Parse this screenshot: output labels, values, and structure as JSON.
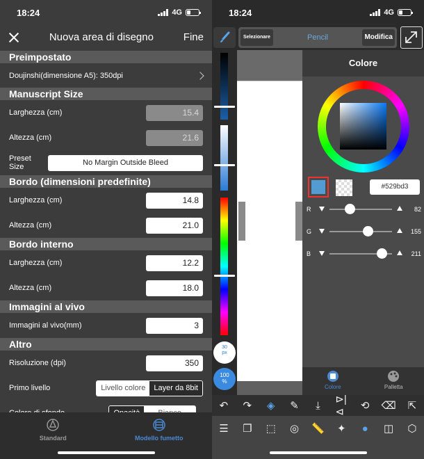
{
  "left": {
    "status_time": "18:24",
    "status_network": "4G",
    "nav": {
      "title": "Nuova area di disegno",
      "done": "Fine"
    },
    "preset": {
      "header": "Preimpostato",
      "value": "Doujinshi(dimensione A5): 350dpi"
    },
    "manuscript": {
      "header": "Manuscript Size",
      "width_label": "Larghezza (cm)",
      "width_value": "15.4",
      "height_label": "Altezza (cm)",
      "height_value": "21.6",
      "preset_label": "Preset Size",
      "preset_value": "No Margin Outside Bleed"
    },
    "bordo": {
      "header": "Bordo (dimensioni predefinite)",
      "width_label": "Larghezza (cm)",
      "width_value": "14.8",
      "height_label": "Altezza (cm)",
      "height_value": "21.0"
    },
    "bordo_interno": {
      "header": "Bordo interno",
      "width_label": "Larghezza (cm)",
      "width_value": "12.2",
      "height_label": "Altezza (cm)",
      "height_value": "18.0"
    },
    "bleed": {
      "header": "Immagini al vivo",
      "label": "Immagini al vivo(mm)",
      "value": "3"
    },
    "altro": {
      "header": "Altro",
      "res_label": "Risoluzione (dpi)",
      "res_value": "350",
      "layer_label": "Primo livello",
      "layer_opt1": "Livello colore",
      "layer_opt2": "Layer da 8bit",
      "bg_label": "Colore di sfondo",
      "bg_opt1": "Opacità",
      "bg_opt2": "Bianco"
    },
    "tabs": {
      "standard": "Standard",
      "comic": "Modello fumetto"
    }
  },
  "right": {
    "status_time": "18:24",
    "status_network": "4G",
    "toolbar": {
      "select": "Selezionare",
      "tool": "Pencil",
      "modify": "Modifica"
    },
    "brush_size": "30\npx",
    "opacity": "100\n%",
    "panel": {
      "title": "Colore",
      "hex": "#529bd3",
      "r_label": "R",
      "r_value": "82",
      "g_label": "G",
      "g_value": "155",
      "b_label": "B",
      "b_value": "211",
      "tab_color": "Colore",
      "tab_palette": "Palletta"
    },
    "r_frac": 0.32,
    "g_frac": 0.61,
    "b_frac": 0.83,
    "colors": {
      "accent": "#4a8ad4",
      "current": "#529bd3"
    }
  }
}
